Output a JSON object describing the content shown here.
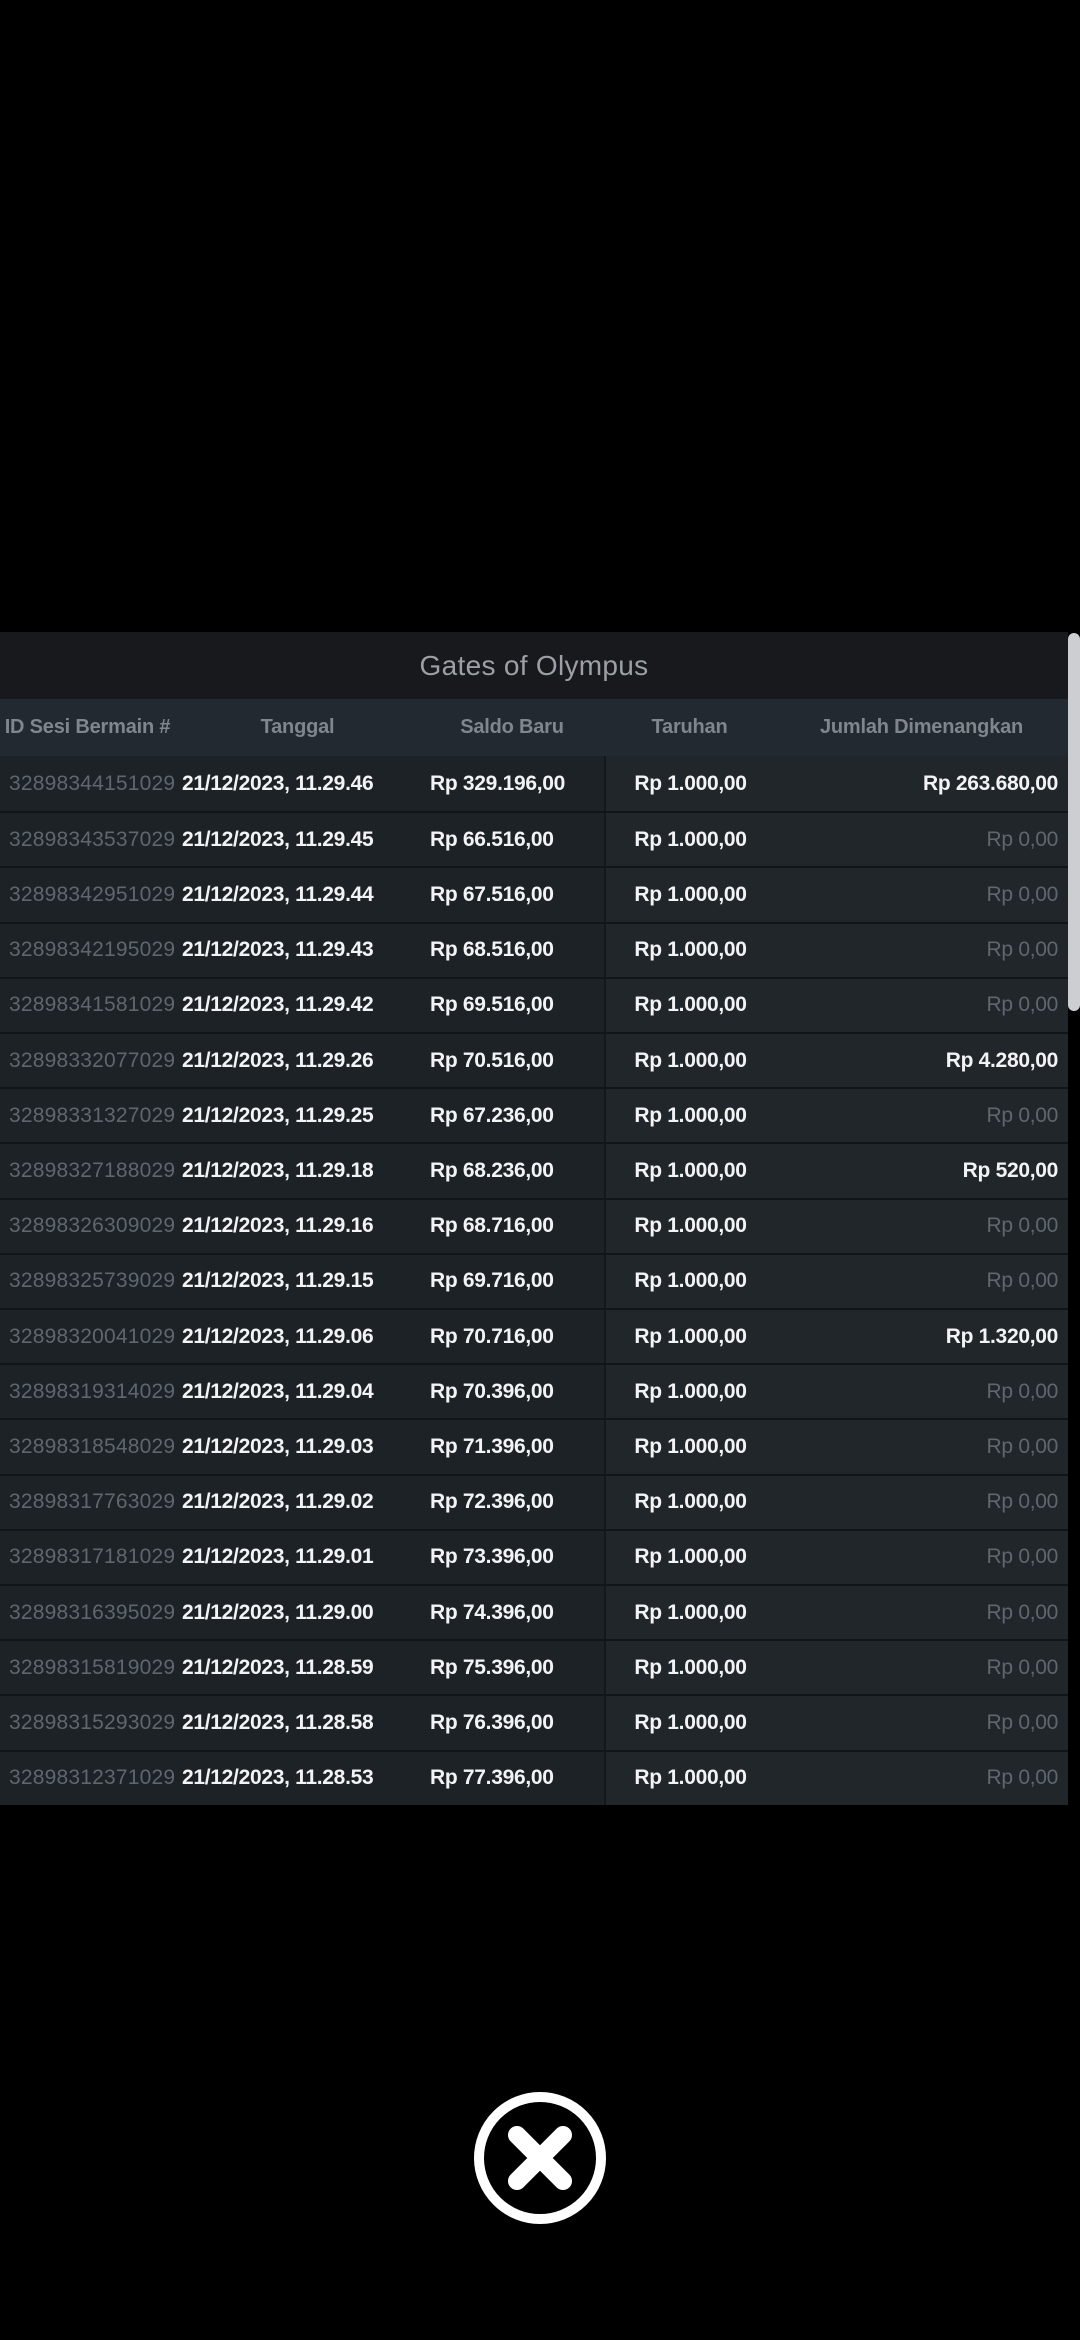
{
  "theme": {
    "page_bg": "#000000",
    "title_bg": "#17191d",
    "title_text": "#9aa0a5",
    "header_bg": "#232930",
    "header_text": "#80868c",
    "row_bg": "#1d2227",
    "row_bg_right": "#21262b",
    "row_border": "#111519",
    "divider": "#14181c",
    "text_bright": "#f1f3f5",
    "text_dim": "#5f666d",
    "scrollbar": "#ccced1",
    "icon": "#ffffff"
  },
  "panel": {
    "title": "Gates of Olympus"
  },
  "table": {
    "columns": [
      "ID Sesi Bermain #",
      "Tanggal",
      "Saldo Baru",
      "Taruhan",
      "Jumlah Dimenangkan"
    ],
    "zero_value": "Rp 0,00",
    "rows": [
      {
        "id": "32898344151029",
        "tanggal": "21/12/2023, 11.29.46",
        "saldo": "Rp 329.196,00",
        "taruhan": "Rp 1.000,00",
        "menang": "Rp 263.680,00"
      },
      {
        "id": "32898343537029",
        "tanggal": "21/12/2023, 11.29.45",
        "saldo": "Rp 66.516,00",
        "taruhan": "Rp 1.000,00",
        "menang": "Rp 0,00"
      },
      {
        "id": "32898342951029",
        "tanggal": "21/12/2023, 11.29.44",
        "saldo": "Rp 67.516,00",
        "taruhan": "Rp 1.000,00",
        "menang": "Rp 0,00"
      },
      {
        "id": "32898342195029",
        "tanggal": "21/12/2023, 11.29.43",
        "saldo": "Rp 68.516,00",
        "taruhan": "Rp 1.000,00",
        "menang": "Rp 0,00"
      },
      {
        "id": "32898341581029",
        "tanggal": "21/12/2023, 11.29.42",
        "saldo": "Rp 69.516,00",
        "taruhan": "Rp 1.000,00",
        "menang": "Rp 0,00"
      },
      {
        "id": "32898332077029",
        "tanggal": "21/12/2023, 11.29.26",
        "saldo": "Rp 70.516,00",
        "taruhan": "Rp 1.000,00",
        "menang": "Rp 4.280,00"
      },
      {
        "id": "32898331327029",
        "tanggal": "21/12/2023, 11.29.25",
        "saldo": "Rp 67.236,00",
        "taruhan": "Rp 1.000,00",
        "menang": "Rp 0,00"
      },
      {
        "id": "32898327188029",
        "tanggal": "21/12/2023, 11.29.18",
        "saldo": "Rp 68.236,00",
        "taruhan": "Rp 1.000,00",
        "menang": "Rp 520,00"
      },
      {
        "id": "32898326309029",
        "tanggal": "21/12/2023, 11.29.16",
        "saldo": "Rp 68.716,00",
        "taruhan": "Rp 1.000,00",
        "menang": "Rp 0,00"
      },
      {
        "id": "32898325739029",
        "tanggal": "21/12/2023, 11.29.15",
        "saldo": "Rp 69.716,00",
        "taruhan": "Rp 1.000,00",
        "menang": "Rp 0,00"
      },
      {
        "id": "32898320041029",
        "tanggal": "21/12/2023, 11.29.06",
        "saldo": "Rp 70.716,00",
        "taruhan": "Rp 1.000,00",
        "menang": "Rp 1.320,00"
      },
      {
        "id": "32898319314029",
        "tanggal": "21/12/2023, 11.29.04",
        "saldo": "Rp 70.396,00",
        "taruhan": "Rp 1.000,00",
        "menang": "Rp 0,00"
      },
      {
        "id": "32898318548029",
        "tanggal": "21/12/2023, 11.29.03",
        "saldo": "Rp 71.396,00",
        "taruhan": "Rp 1.000,00",
        "menang": "Rp 0,00"
      },
      {
        "id": "32898317763029",
        "tanggal": "21/12/2023, 11.29.02",
        "saldo": "Rp 72.396,00",
        "taruhan": "Rp 1.000,00",
        "menang": "Rp 0,00"
      },
      {
        "id": "32898317181029",
        "tanggal": "21/12/2023, 11.29.01",
        "saldo": "Rp 73.396,00",
        "taruhan": "Rp 1.000,00",
        "menang": "Rp 0,00"
      },
      {
        "id": "32898316395029",
        "tanggal": "21/12/2023, 11.29.00",
        "saldo": "Rp 74.396,00",
        "taruhan": "Rp 1.000,00",
        "menang": "Rp 0,00"
      },
      {
        "id": "32898315819029",
        "tanggal": "21/12/2023, 11.28.59",
        "saldo": "Rp 75.396,00",
        "taruhan": "Rp 1.000,00",
        "menang": "Rp 0,00"
      },
      {
        "id": "32898315293029",
        "tanggal": "21/12/2023, 11.28.58",
        "saldo": "Rp 76.396,00",
        "taruhan": "Rp 1.000,00",
        "menang": "Rp 0,00"
      },
      {
        "id": "32898312371029",
        "tanggal": "21/12/2023, 11.28.53",
        "saldo": "Rp 77.396,00",
        "taruhan": "Rp 1.000,00",
        "menang": "Rp 0,00"
      }
    ]
  },
  "close_button": {
    "icon": "x-circle"
  }
}
